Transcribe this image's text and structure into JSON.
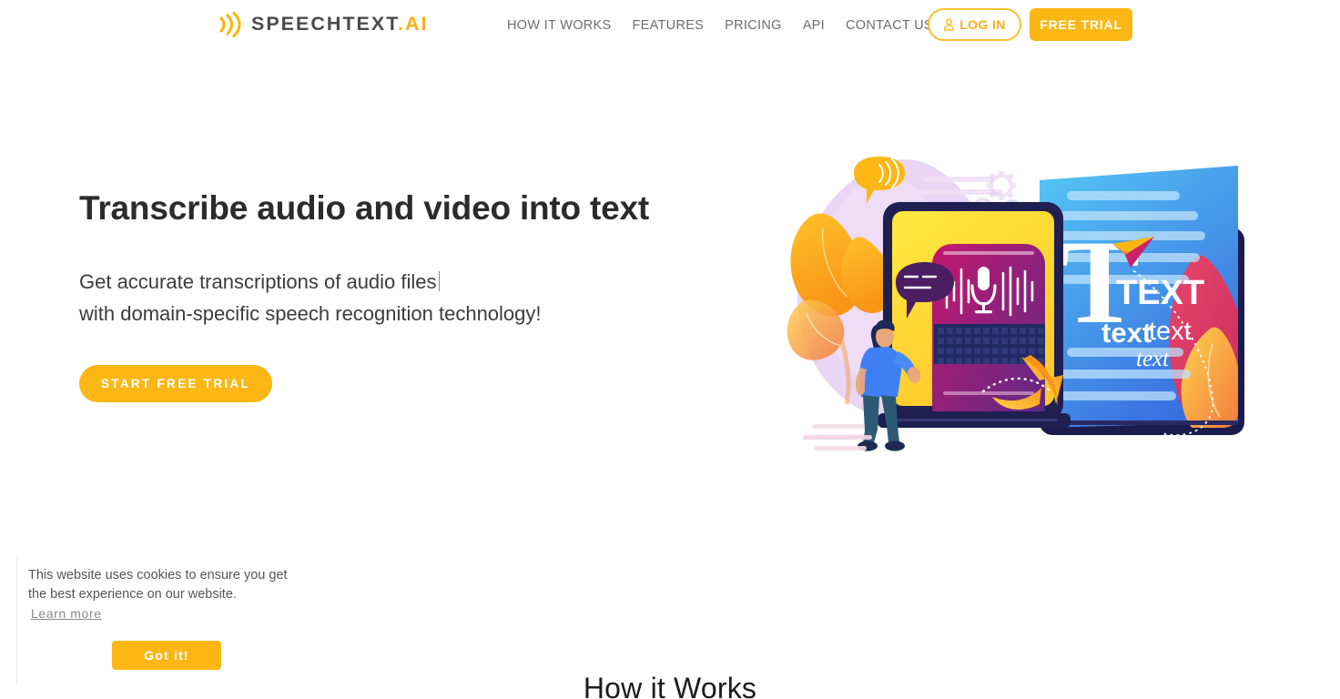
{
  "header": {
    "logo": {
      "icon": "sound-wave-icon",
      "name": "SPEECHTEXT",
      "suffix": ".AI"
    },
    "nav": [
      {
        "label": "HOW IT WORKS"
      },
      {
        "label": "FEATURES"
      },
      {
        "label": "PRICING"
      },
      {
        "label": "API"
      },
      {
        "label": "CONTACT US"
      }
    ],
    "login_button": {
      "label": "LOG IN",
      "icon": "user-icon"
    },
    "free_trial_button": {
      "label": "FREE TRIAL"
    }
  },
  "hero": {
    "title": "Transcribe audio and video into text",
    "subtitle_line1": "Get accurate transcriptions of audio files",
    "subtitle_line2": "with domain-specific speech recognition technology!",
    "cta_label": "START FREE TRIAL",
    "illustration": {
      "name": "speech-to-text-illustration",
      "text_large": "T",
      "text_caps": "TEXT",
      "text_small_1": "text",
      "text_small_2": "text",
      "text_italic": "text"
    }
  },
  "cookie_banner": {
    "message": "This website uses cookies to ensure you get the best experience on our website.",
    "learn_more_label": "Learn more",
    "accept_label": "Got it!"
  },
  "section_how_it_works": {
    "title": "How it Works"
  },
  "colors": {
    "accent_orange": "#FDB714",
    "logo_amber": "#FBAF17",
    "text_dark": "#2b2b2b",
    "text_muted": "#6d6d6d"
  }
}
